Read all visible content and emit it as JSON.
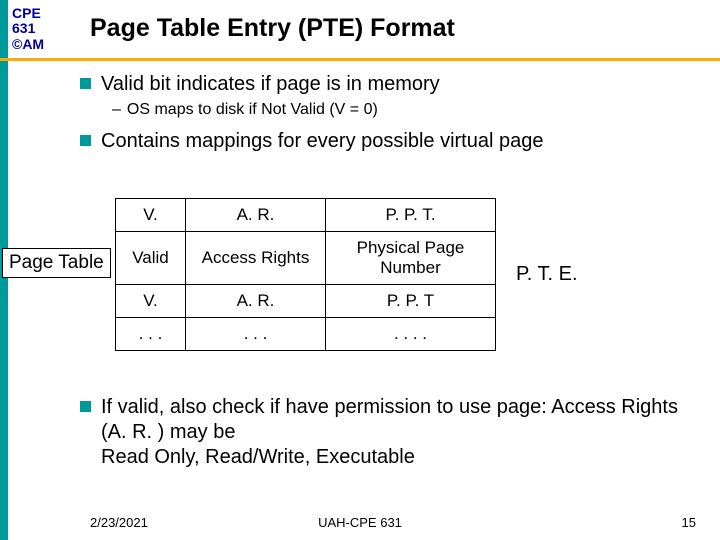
{
  "badge": {
    "line1": "CPE",
    "line2": "631",
    "line3": "©AM"
  },
  "title": "Page Table Entry (PTE) Format",
  "bullets": {
    "b1": "Valid bit indicates if page is in memory",
    "b1sub": "OS maps to disk if Not Valid  (V = 0)",
    "b2": "Contains mappings for every possible virtual page",
    "b3": "If valid, also check if have permission to use page: Access Rights (A. R. ) may be\nRead Only, Read/Write, Executable"
  },
  "page_table_label": "Page Table",
  "pte_side_label": "P. T. E.",
  "table": {
    "r0": {
      "c0": "V.",
      "c1": "A. R.",
      "c2": "P. P. T."
    },
    "r1": {
      "c0": "Valid",
      "c1": "Access Rights",
      "c2": "Physical Page Number"
    },
    "r2": {
      "c0": "V.",
      "c1": "A. R.",
      "c2": "P. P. T"
    },
    "r3": {
      "c0": ". . .",
      "c1": ". . .",
      "c2": ". . . ."
    }
  },
  "footer": {
    "date": "2/23/2021",
    "center": "UAH-CPE 631",
    "page": "15"
  }
}
